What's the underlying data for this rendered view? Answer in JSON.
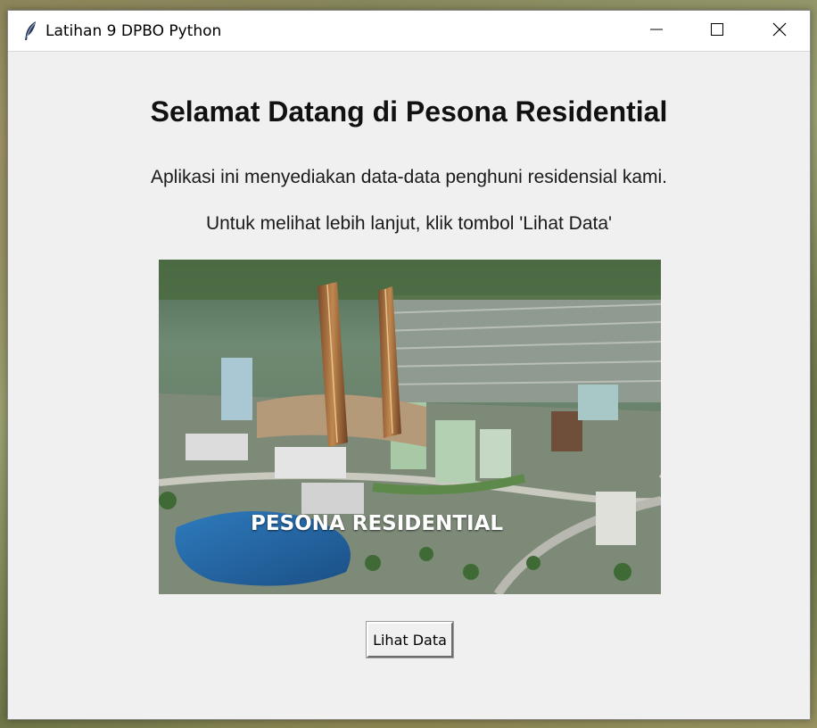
{
  "window": {
    "title": "Latihan 9 DPBO Python",
    "icon": "feather-icon",
    "controls": [
      "minimize-icon",
      "maximize-icon",
      "close-icon"
    ]
  },
  "main": {
    "heading": "Selamat Datang di Pesona Residential",
    "line1": "Aplikasi ini menyediakan data-data penghuni residensial kami.",
    "line2": "Untuk melihat lebih lanjut, klik tombol 'Lihat Data'",
    "image_caption": "PESONA RESIDENTIAL",
    "button_label": "Lihat Data"
  },
  "colors": {
    "window_bg": "#f0f0f0",
    "titlebar_bg": "#ffffff"
  }
}
